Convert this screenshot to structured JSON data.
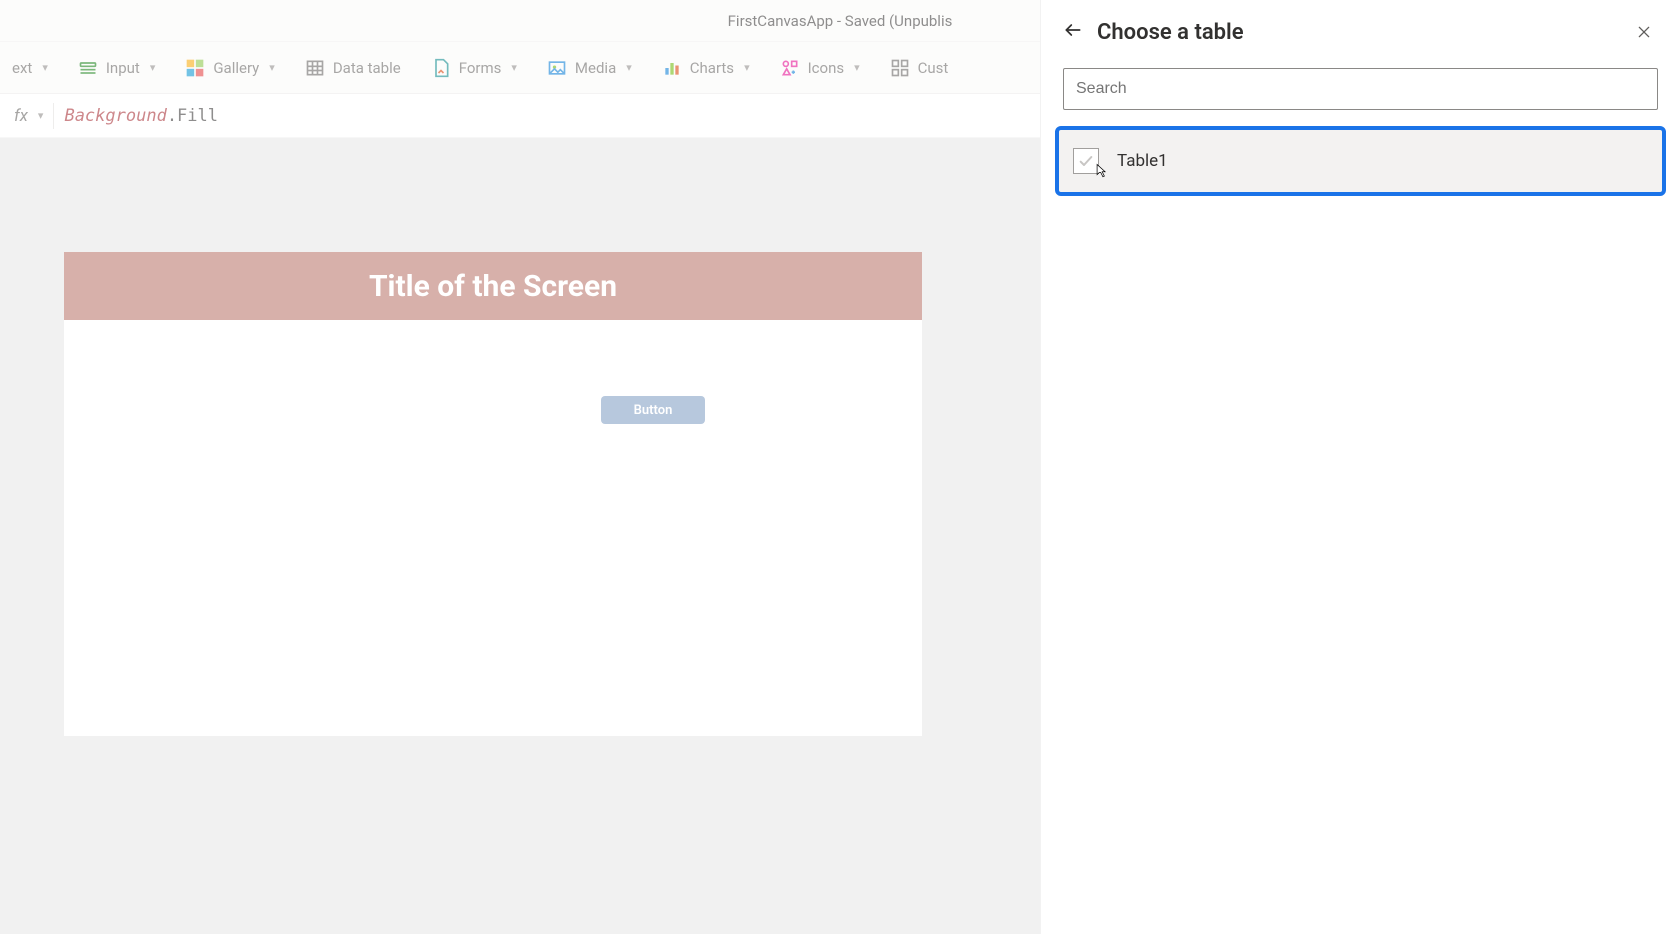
{
  "titlebar": {
    "text": "FirstCanvasApp - Saved (Unpublis"
  },
  "ribbon": {
    "items": [
      {
        "label": "ext",
        "icon": "text-icon",
        "dropdown": true
      },
      {
        "label": "Input",
        "icon": "input-icon",
        "dropdown": true
      },
      {
        "label": "Gallery",
        "icon": "gallery-icon",
        "dropdown": true
      },
      {
        "label": "Data table",
        "icon": "data-table-icon",
        "dropdown": false
      },
      {
        "label": "Forms",
        "icon": "forms-icon",
        "dropdown": true
      },
      {
        "label": "Media",
        "icon": "media-icon",
        "dropdown": true
      },
      {
        "label": "Charts",
        "icon": "charts-icon",
        "dropdown": true
      },
      {
        "label": "Icons",
        "icon": "icons-icon",
        "dropdown": true
      },
      {
        "label": "Cust",
        "icon": "custom-icon",
        "dropdown": false
      }
    ]
  },
  "formula_bar": {
    "fx_label": "fx",
    "error_token": "Background",
    "rest_token": ".Fill"
  },
  "canvas": {
    "title": "Title of the Screen",
    "button_label": "Button"
  },
  "panel": {
    "title": "Choose a table",
    "search_placeholder": "Search",
    "tables": [
      {
        "name": "Table1",
        "selected": true
      }
    ]
  }
}
